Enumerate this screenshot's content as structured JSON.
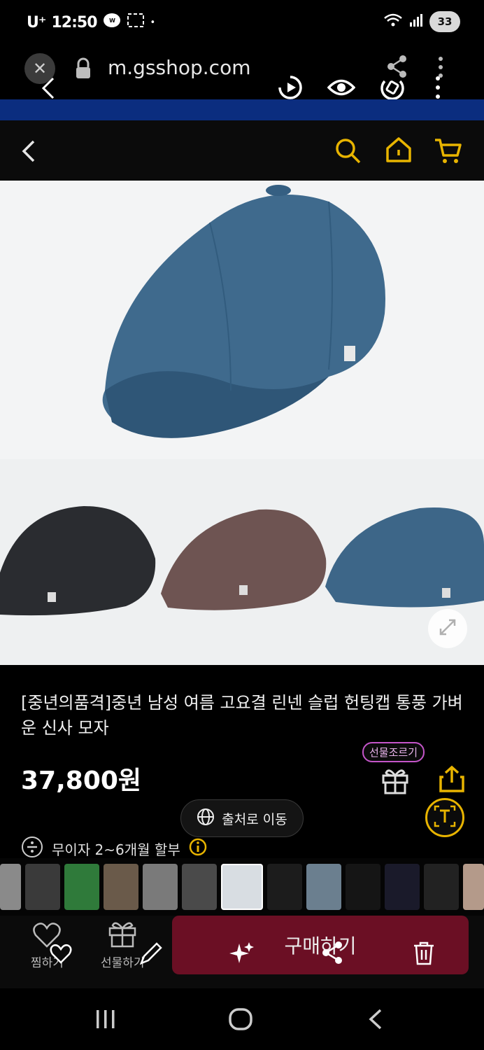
{
  "status_bar": {
    "carrier": "U⁺",
    "time": "12:50",
    "dot": "•",
    "battery": "33"
  },
  "browser": {
    "url": "m.gsshop.com"
  },
  "product": {
    "title": "[중년의품격]중년 남성 여름 고요결 린넨 슬럽 헌팅캡 통풍 가벼운 신사 모자",
    "price": "37,800원",
    "gift_badge": "선물조르기",
    "source_button": "출처로 이동",
    "installment": "무이자 2~6개월 할부"
  },
  "bottom_bar": {
    "wish_label": "찜하기",
    "gift_label": "선물하기",
    "buy_label": "구매하기"
  },
  "colors": {
    "accent_yellow": "#e8b400",
    "buy_button": "#6b0f24",
    "gift_badge_border": "#c455c9",
    "header_strip": "#0b2d7f"
  }
}
